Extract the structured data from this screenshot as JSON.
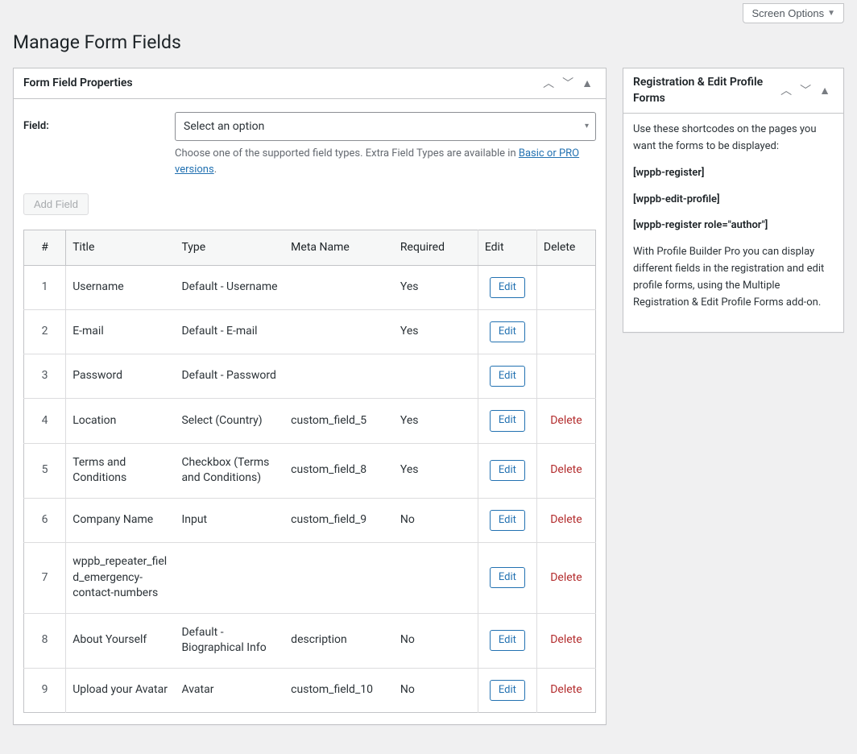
{
  "topbar": {
    "screen_options": "Screen Options"
  },
  "page": {
    "title": "Manage Form Fields"
  },
  "panel_main": {
    "title": "Form Field Properties",
    "field_label": "Field:",
    "select_placeholder": "Select an option",
    "help_text_prefix": "Choose one of the supported field types. Extra Field Types are available in ",
    "help_text_link": "Basic or PRO versions",
    "help_text_suffix": ".",
    "add_field_label": "Add Field"
  },
  "table": {
    "headers": {
      "num": "#",
      "title": "Title",
      "type": "Type",
      "meta": "Meta Name",
      "required": "Required",
      "edit": "Edit",
      "delete": "Delete"
    },
    "edit_label": "Edit",
    "delete_label": "Delete",
    "rows": [
      {
        "num": "1",
        "title": "Username",
        "type": "Default - Username",
        "meta": "",
        "required": "Yes",
        "can_delete": false
      },
      {
        "num": "2",
        "title": "E-mail",
        "type": "Default - E-mail",
        "meta": "",
        "required": "Yes",
        "can_delete": false
      },
      {
        "num": "3",
        "title": "Password",
        "type": "Default - Password",
        "meta": "",
        "required": "",
        "can_delete": false
      },
      {
        "num": "4",
        "title": "Location",
        "type": "Select (Country)",
        "meta": "custom_field_5",
        "required": "Yes",
        "can_delete": true
      },
      {
        "num": "5",
        "title": "Terms and Conditions",
        "type": "Checkbox (Terms and Conditions)",
        "meta": "custom_field_8",
        "required": "Yes",
        "can_delete": true
      },
      {
        "num": "6",
        "title": "Company Name",
        "type": "Input",
        "meta": "custom_field_9",
        "required": "No",
        "can_delete": true
      },
      {
        "num": "7",
        "title": "wppb_repeater_field_emergency-contact-numbers",
        "type": "",
        "meta": "",
        "required": "",
        "can_delete": true
      },
      {
        "num": "8",
        "title": "About Yourself",
        "type": "Default - Biographical Info",
        "meta": "description",
        "required": "No",
        "can_delete": true
      },
      {
        "num": "9",
        "title": "Upload your Avatar",
        "type": "Avatar",
        "meta": "custom_field_10",
        "required": "No",
        "can_delete": true
      }
    ]
  },
  "sidebar": {
    "title": "Registration & Edit Profile Forms",
    "intro": "Use these shortcodes on the pages you want the forms to be displayed:",
    "shortcodes": [
      "[wppb-register]",
      "[wppb-edit-profile]",
      "[wppb-register role=\"author\"]"
    ],
    "note": "With Profile Builder Pro you can display different fields in the registration and edit profile forms, using the Multiple Registration & Edit Profile Forms add-on."
  }
}
